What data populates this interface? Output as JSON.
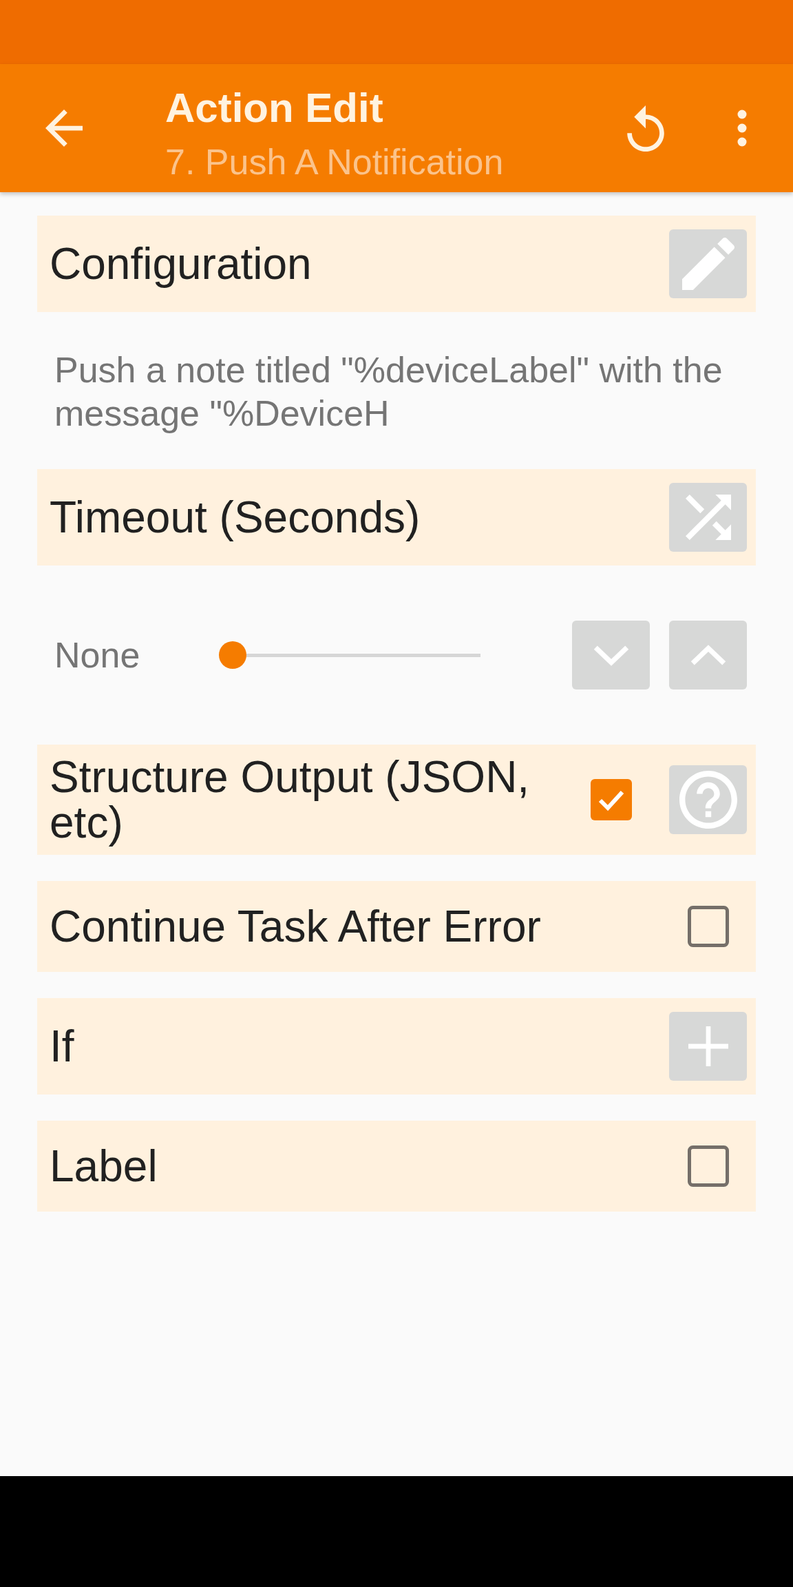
{
  "app_bar": {
    "title": "Action Edit",
    "subtitle": "7. Push A Notification"
  },
  "rows": [
    {
      "kind": "edit",
      "label": "Configuration"
    },
    {
      "kind": "text",
      "text": "Push a note titled \"%deviceLabel\" with the message \"%DeviceH"
    },
    {
      "kind": "variable",
      "label": "Timeout (Seconds)"
    },
    {
      "kind": "slider",
      "value": "None",
      "level": 0
    },
    {
      "kind": "check",
      "label": "Structure Output (JSON, etc)",
      "checked": true,
      "help": true
    },
    {
      "kind": "check",
      "label": "Continue Task After Error",
      "checked": false,
      "help": false
    },
    {
      "kind": "add",
      "label": "If"
    },
    {
      "kind": "check",
      "label": "Label",
      "checked": false,
      "help": false
    }
  ]
}
